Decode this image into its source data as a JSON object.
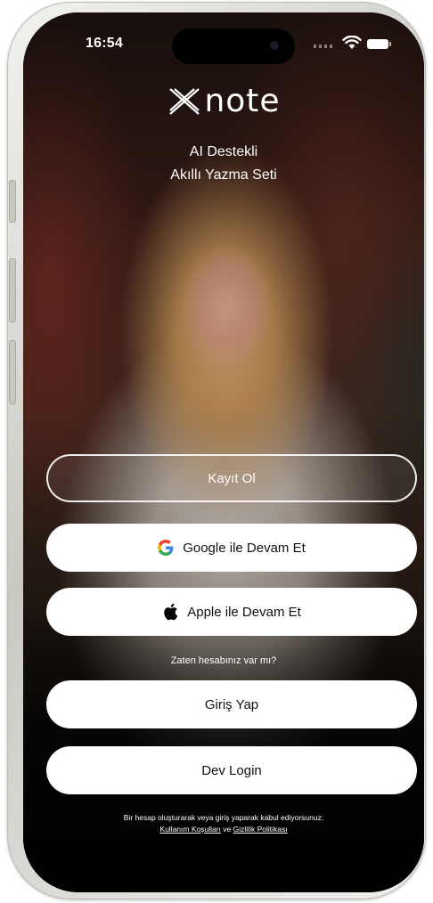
{
  "status_bar": {
    "time": "16:54"
  },
  "brand": {
    "logo_rest": "note",
    "logo_mark": "X"
  },
  "tagline": {
    "line1": "AI Destekli",
    "line2": "Akıllı Yazma Seti"
  },
  "buttons": {
    "register": "Kayıt Ol",
    "google": "Google ile Devam Et",
    "apple": "Apple ile Devam Et",
    "login": "Giriş Yap",
    "dev_login": "Dev Login"
  },
  "have_account": "Zaten hesabınız var mı?",
  "legal": {
    "text": "Bir hesap oluşturarak veya giriş yaparak kabul ediyorsunuz:",
    "terms": "Kullanım Koşulları",
    "and": "ve",
    "privacy": "Gizlilik Politikası"
  },
  "icons": {
    "google": "google-icon",
    "apple": "apple-icon",
    "wifi": "wifi-icon",
    "battery": "battery-icon",
    "signal": "signal-icon"
  },
  "colors": {
    "button_bg": "#ffffff",
    "button_text": "#111111",
    "google_blue": "#4285F4",
    "google_red": "#EA4335",
    "google_yellow": "#FBBC05",
    "google_green": "#34A853"
  }
}
